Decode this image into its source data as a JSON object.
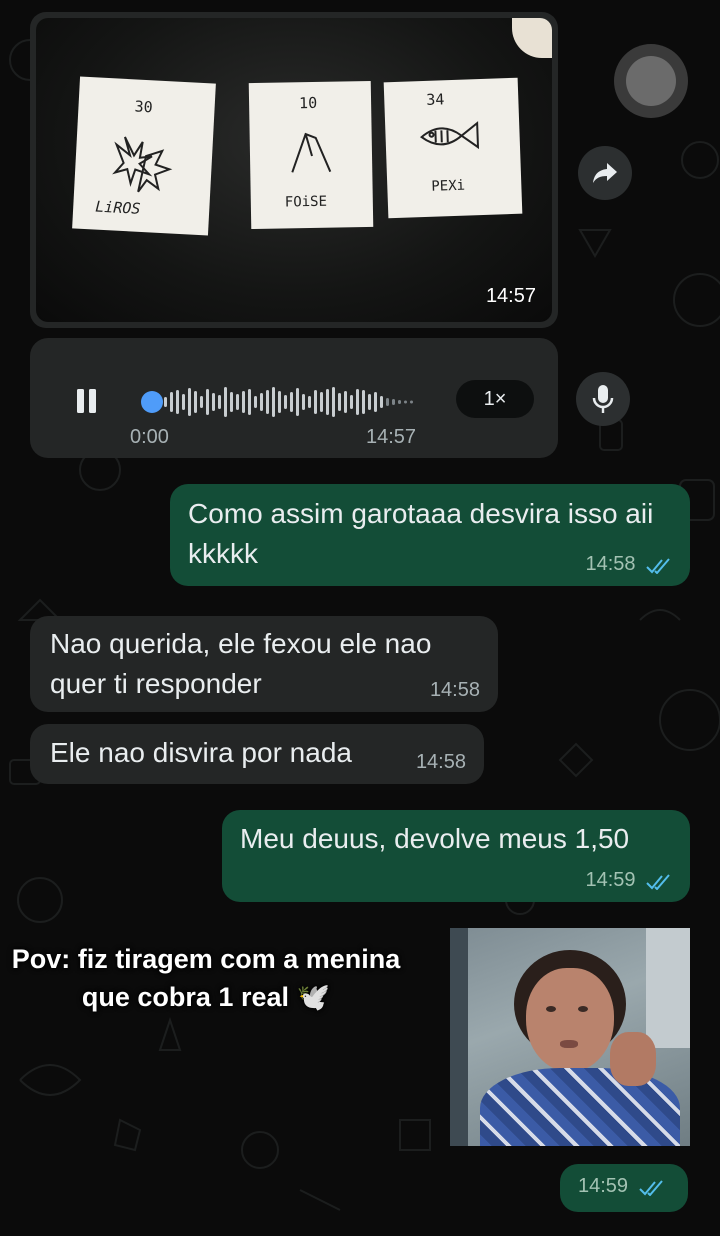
{
  "photo_message": {
    "time": "14:57",
    "cards": [
      {
        "number": "30",
        "word": "LiROS"
      },
      {
        "number": "10",
        "word": "FOiSE"
      },
      {
        "number": "34",
        "word": "PEXi"
      }
    ]
  },
  "voice_message": {
    "elapsed": "0:00",
    "time": "14:57",
    "speed": "1×",
    "progress": 0
  },
  "messages": [
    {
      "direction": "outgoing",
      "text": "Como assim garotaaa desvira isso aii kkkkk",
      "time": "14:58",
      "status": "read"
    },
    {
      "direction": "incoming",
      "text": "Nao querida, ele fexou ele nao quer ti responder",
      "time": "14:58"
    },
    {
      "direction": "incoming",
      "text": "Ele nao disvira por nada",
      "time": "14:58"
    },
    {
      "direction": "outgoing",
      "text": "Meu deuus, devolve meus 1,50",
      "time": "14:59",
      "status": "read"
    },
    {
      "direction": "outgoing",
      "text": "",
      "time": "14:59",
      "status": "read"
    }
  ],
  "overlay_caption": "Pov: fiz tiragem com a menina que cobra 1 real 🕊️",
  "icons": {
    "forward": "forward-arrow-icon",
    "mic": "microphone-icon",
    "pause": "pause-icon",
    "read": "double-check-icon"
  },
  "colors": {
    "outgoing_bubble": "#134d37",
    "incoming_bubble": "#242626",
    "read_ticks": "#53bdeb",
    "playhead": "#4f9cf9"
  }
}
